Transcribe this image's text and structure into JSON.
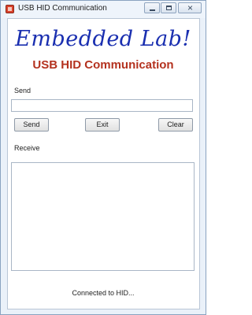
{
  "window": {
    "title": "USB HID Communication",
    "controls": {
      "minimize": "minimize",
      "maximize": "maximize",
      "close": "×"
    }
  },
  "header": {
    "brand": "Embedded Lab!",
    "subtitle": "USB HID Communication"
  },
  "send": {
    "label": "Send",
    "value": "",
    "placeholder": ""
  },
  "buttons": {
    "send": "Send",
    "exit": "Exit",
    "clear": "Clear"
  },
  "receive": {
    "label": "Receive",
    "value": ""
  },
  "status": {
    "text": "Connected to HID..."
  },
  "colors": {
    "brand": "#1a2fb0",
    "subtitle": "#b4321f"
  }
}
